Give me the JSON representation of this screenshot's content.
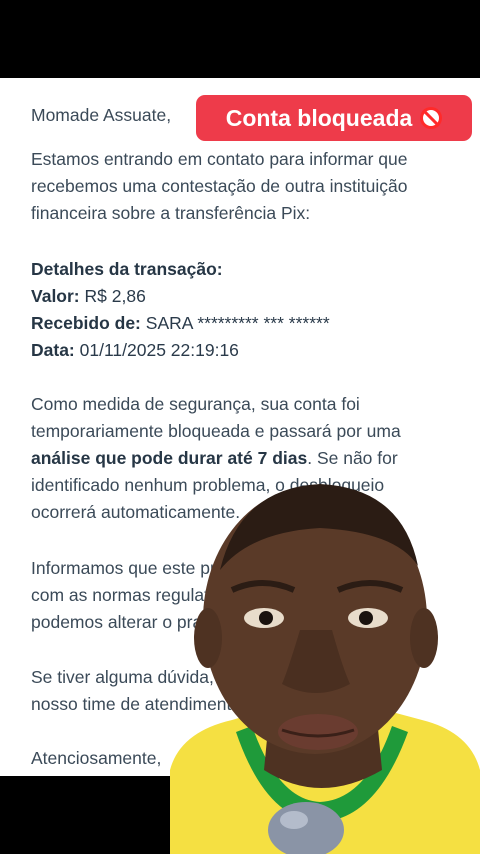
{
  "email": {
    "greeting": "Momade Assuate,",
    "paragraph1": [
      "Estamos entrando em contato para informar que",
      "recebemos uma contestação de outra instituição",
      "financeira sobre a transferência Pix:"
    ],
    "details": {
      "heading": "Detalhes da transação:",
      "valor_label": "Valor:",
      "valor": "R$ 2,86",
      "recebido_label": "Recebido de:",
      "recebido": "SARA ********* *** ******",
      "data_label": "Data:",
      "data": "01/11/2025 22:19:16"
    },
    "paragraph2": {
      "line1": "Como medida de segurança, sua conta foi",
      "line2": "temporariamente bloqueada e passará por uma",
      "line3_bold": "análise que pode durar até 7 dias",
      "line3_rest": ". Se não for",
      "line4": "identificado nenhum problema, o desbloqueio",
      "line5": "ocorrerá automaticamente."
    },
    "paragraph3": [
      "Informamos que este processo segue de acordo",
      "com as normas regulatórias e que não",
      "podemos alterar o prazo."
    ],
    "paragraph4": [
      "Se tiver alguma dúvida, entre em contato com o",
      "nosso time de atendimento."
    ],
    "signoff": "Atenciosamente,"
  },
  "badge": {
    "label": "Conta bloqueada",
    "icon": "prohibited-icon",
    "color": "#ee3b4a"
  },
  "overlay": {
    "shirt_color": "#f5e042",
    "collar_color": "#1f9a3a",
    "skin_color": "#5a3a28"
  }
}
